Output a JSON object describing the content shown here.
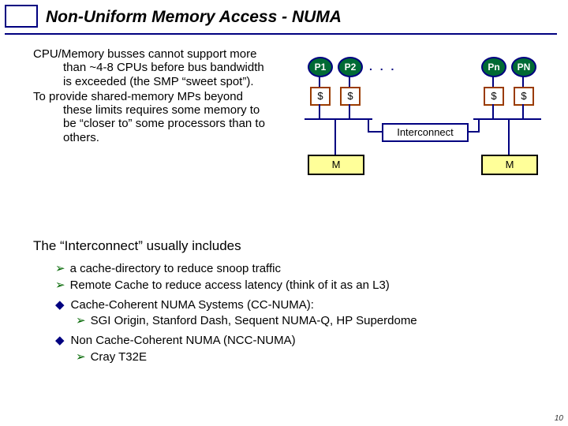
{
  "title": "Non-Uniform Memory Access - NUMA",
  "para1": "CPU/Memory busses cannot support more than ~4-8 CPUs before bus bandwidth is exceeded (the SMP “sweet spot”).",
  "para2": "To provide shared-memory MPs beyond these limits requires some memory to be “closer to” some processors than to others.",
  "sec_title": "The “Interconnect” usually includes",
  "b1": "a cache-directory to reduce snoop traffic",
  "b2": "Remote Cache to reduce access latency (think of it as an L3)",
  "h1": "Cache-Coherent NUMA Systems (CC-NUMA):",
  "b3": "SGI Origin, Stanford Dash, Sequent NUMA-Q, HP Superdome",
  "h2": "Non Cache-Coherent NUMA (NCC-NUMA)",
  "b4": "Cray T32E",
  "slide_num": "10",
  "diagram": {
    "p1": "P1",
    "p2": "P2",
    "pn": "Pn",
    "pN": "PN",
    "cache": "$",
    "dots": ". . .",
    "mem": "M",
    "inter": "Interconnect"
  }
}
